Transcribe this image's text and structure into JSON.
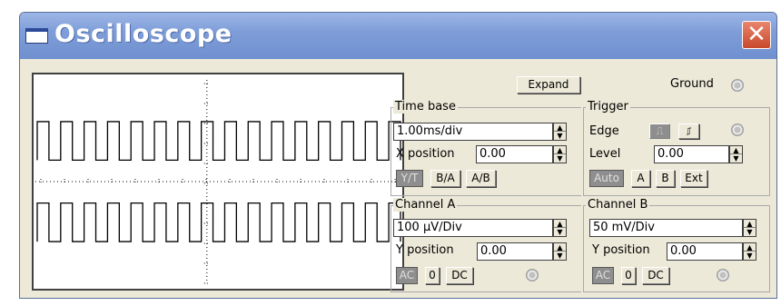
{
  "window": {
    "title": "Oscilloscope",
    "close_glyph": "✕"
  },
  "icons": {
    "title_icon": "window-icon",
    "close": "close-icon"
  },
  "display": {
    "waveform": "square",
    "cycles_visible": 15,
    "colors": {
      "background": "#ffffff",
      "trace": "#000000",
      "grid": "#000000"
    }
  },
  "top": {
    "expand_label": "Expand",
    "ground_label": "Ground"
  },
  "timebase": {
    "title": "Time base",
    "scale_value": "1.00ms/div",
    "xpos_label": "X position",
    "xpos_value": "0.00",
    "modes": [
      "Y/T",
      "B/A",
      "A/B"
    ],
    "active_mode": "Y/T"
  },
  "trigger": {
    "title": "Trigger",
    "edge_label": "Edge",
    "level_label": "Level",
    "level_value": "0.00",
    "sources": [
      "Auto",
      "A",
      "B",
      "Ext"
    ],
    "active_source": "Auto"
  },
  "channel_a": {
    "title": "Channel A",
    "scale_value": "100 µV/Div",
    "ypos_label": "Y position",
    "ypos_value": "0.00",
    "coupling": [
      "AC",
      "0",
      "DC"
    ],
    "active_coupling": "AC"
  },
  "channel_b": {
    "title": "Channel B",
    "scale_value": "50 mV/Div",
    "ypos_label": "Y position",
    "ypos_value": "0.00",
    "coupling": [
      "AC",
      "0",
      "DC"
    ],
    "active_coupling": "AC"
  },
  "spinner": {
    "up": "▲",
    "down": "▼"
  }
}
